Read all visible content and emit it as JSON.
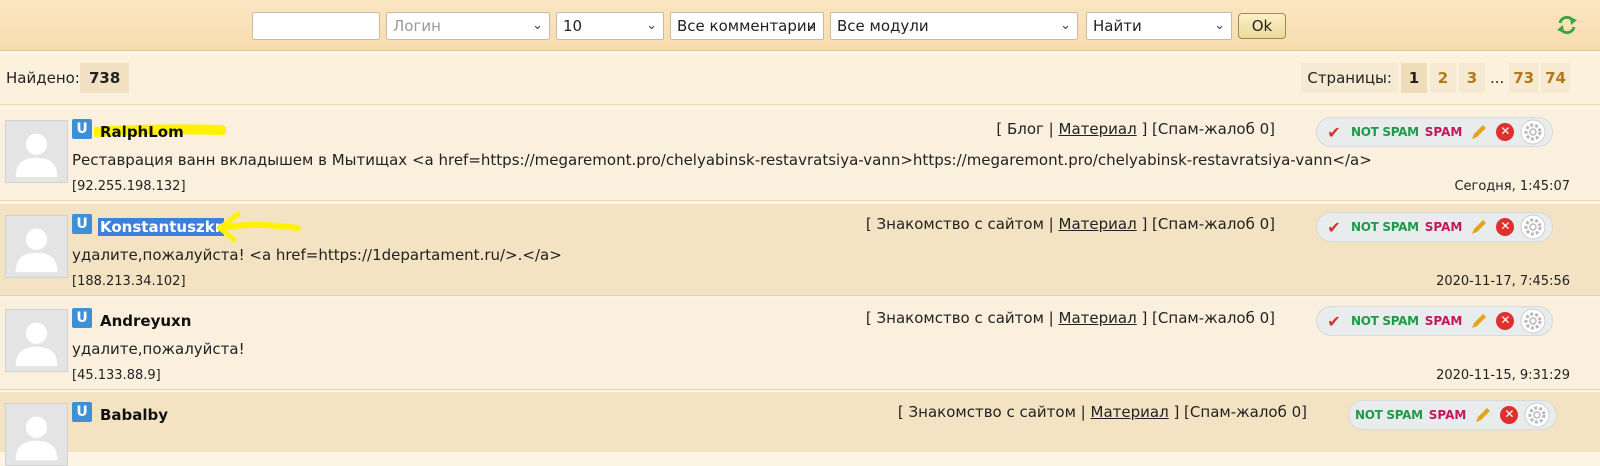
{
  "filters": {
    "text_value": "",
    "login_placeholder": "Логин",
    "per_page": "10",
    "comment_type": "Все комментарии",
    "module": "Все модули",
    "action": "Найти",
    "ok_label": "Ok"
  },
  "summary": {
    "found_label": "Найдено:",
    "found_count": "738"
  },
  "pager": {
    "label": "Страницы:",
    "pages": [
      "1",
      "2",
      "3",
      "73",
      "74"
    ],
    "ellipsis": "...",
    "current": "1"
  },
  "actions": {
    "not_spam": "NOT SPAM",
    "spam": "SPAM"
  },
  "comments": [
    {
      "username": "RalphLom",
      "meta_pre": "[ Блог | ",
      "meta_link": "Материал",
      "meta_post": " ] [Спам-жалоб 0]",
      "text": "Реставрация ванн вкладышем в Мытищах <a href=https://megaremont.pro/chelyabinsk-restavratsiya-vann>https://megaremont.pro/chelyabinsk-restavratsiya-vann</a>",
      "ip": "[92.255.198.132]",
      "date": "Сегодня, 1:45:07"
    },
    {
      "username": "Konstantuszkr",
      "meta_pre": "[ Знакомство с сайтом | ",
      "meta_link": "Материал",
      "meta_post": " ] [Спам-жалоб 0]",
      "text": "удалите,пожалуйста! <a href=https://1departament.ru/>.</a>",
      "ip": "[188.213.34.102]",
      "date": "2020-11-17, 7:45:56"
    },
    {
      "username": "Andreyuxn",
      "meta_pre": "[ Знакомство с сайтом | ",
      "meta_link": "Материал",
      "meta_post": " ] [Спам-жалоб 0]",
      "text": "удалите,пожалуйста!",
      "ip": "[45.133.88.9]",
      "date": "2020-11-15, 9:31:29"
    },
    {
      "username": "Babalby",
      "meta_pre": "[ Знакомство с сайтом | ",
      "meta_link": "Материал",
      "meta_post": " ] [Спам-жалоб 0]"
    }
  ],
  "colors": {
    "badge_blue": "#3d8fd8",
    "highlight_yellow": "#fff200",
    "selection_blue": "#3f7fdc",
    "not_spam_green": "#1e9a4a",
    "spam_magenta": "#c2185b",
    "delete_red": "#e0302e"
  },
  "icons": [
    "refresh-icon",
    "user-avatar-icon",
    "check-icon",
    "edit-pencil-icon",
    "delete-icon",
    "gear-icon",
    "chevron-down-icon"
  ]
}
